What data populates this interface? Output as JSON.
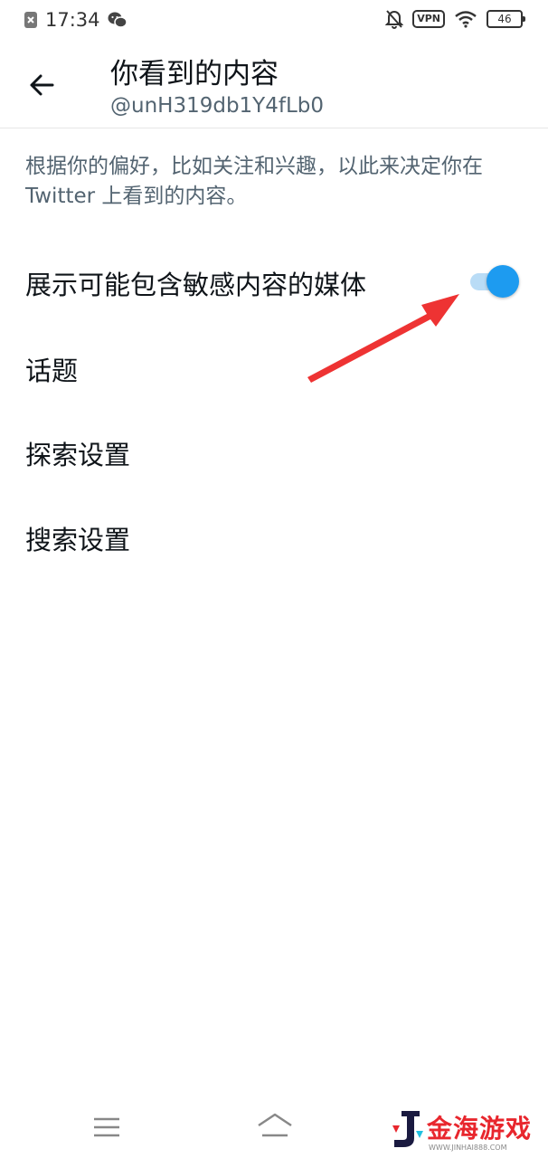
{
  "status_bar": {
    "time": "17:34",
    "vpn": "VPN",
    "battery": "46",
    "icons": [
      "app-close-icon",
      "wechat-icon",
      "bell-off-icon",
      "wifi-icon",
      "battery-icon"
    ]
  },
  "header": {
    "title": "你看到的内容",
    "subtitle": "@unH319db1Y4fLb0"
  },
  "description": "根据你的偏好，比如关注和兴趣，以此来决定你在 Twitter 上看到的内容。",
  "settings": {
    "sensitive_media": {
      "label": "展示可能包含敏感内容的媒体",
      "enabled": true
    },
    "topics": "话题",
    "explore": "探索设置",
    "search": "搜索设置"
  },
  "watermark": {
    "text": "金海游戏",
    "sub": "WWW.JINHAI888.COM"
  },
  "colors": {
    "accent": "#1d9bf0",
    "arrow": "#ee3333",
    "secondary_text": "#536471"
  }
}
